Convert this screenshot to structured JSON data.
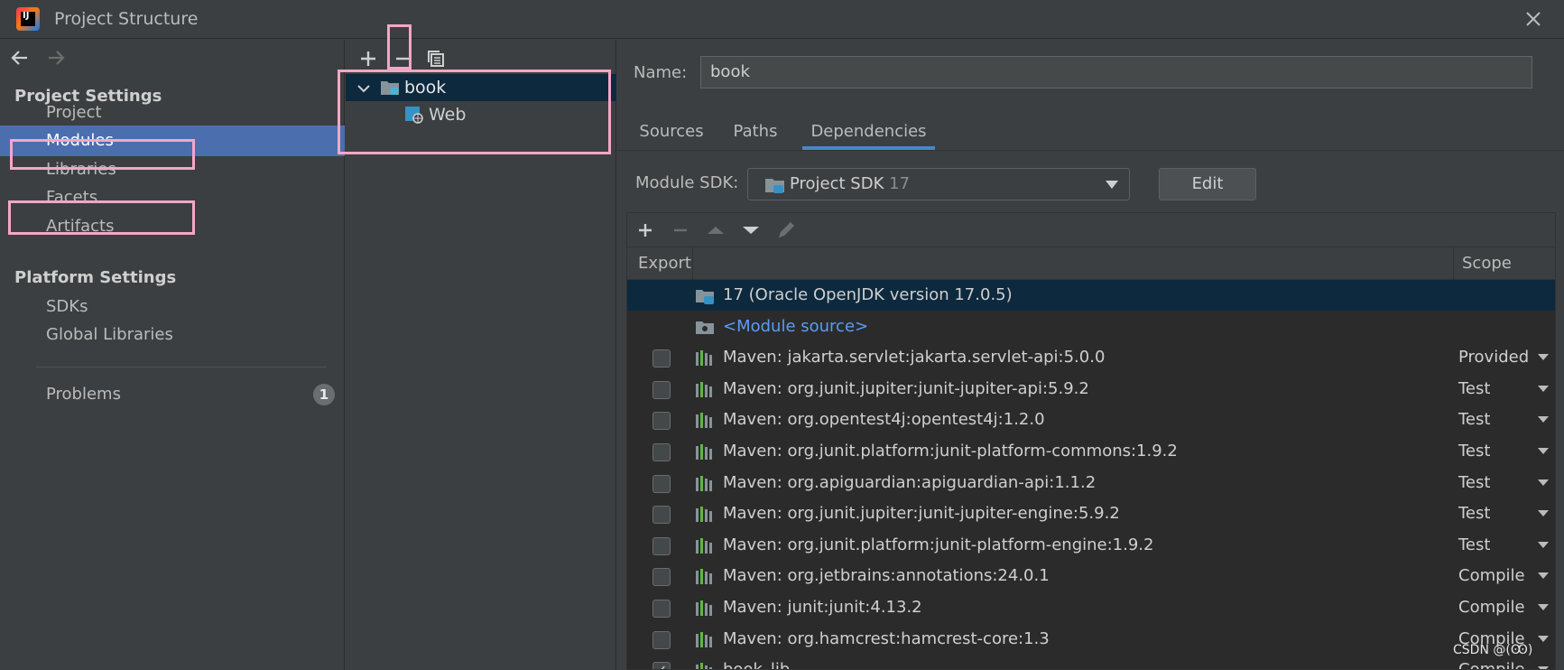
{
  "window": {
    "title": "Project Structure",
    "logo_text": "IJ"
  },
  "sidebar": {
    "project_settings_title": "Project Settings",
    "platform_settings_title": "Platform Settings",
    "project_items": [
      {
        "label": "Project"
      },
      {
        "label": "Modules",
        "selected": true
      },
      {
        "label": "Libraries"
      },
      {
        "label": "Facets"
      },
      {
        "label": "Artifacts"
      }
    ],
    "platform_items": [
      {
        "label": "SDKs"
      },
      {
        "label": "Global Libraries"
      }
    ],
    "problems_label": "Problems",
    "problems_count": "1"
  },
  "tree": {
    "items": [
      {
        "label": "book",
        "level": 0,
        "expanded": true,
        "selected": true,
        "icon": "module-folder-icon"
      },
      {
        "label": "Web",
        "level": 1,
        "icon": "web-facet-icon"
      }
    ]
  },
  "module": {
    "name_label": "Name:",
    "name_value": "book",
    "tabs": [
      {
        "label": "Sources"
      },
      {
        "label": "Paths"
      },
      {
        "label": "Dependencies",
        "active": true
      }
    ],
    "sdk_label": "Module SDK:",
    "sdk_value": "Project SDK",
    "sdk_version": "17",
    "edit_label": "Edit"
  },
  "dependencies": {
    "export_header": "Export",
    "scope_header": "Scope",
    "rows": [
      {
        "name": "17 (Oracle OpenJDK version 17.0.5)",
        "type": "sdk",
        "scope": "",
        "checkbox": false,
        "selected": true
      },
      {
        "name": "<Module source>",
        "type": "source",
        "scope": "",
        "checkbox": false
      },
      {
        "name": "Maven: jakarta.servlet:jakarta.servlet-api:5.0.0",
        "type": "library",
        "scope": "Provided",
        "checkbox": true,
        "checked": false
      },
      {
        "name": "Maven: org.junit.jupiter:junit-jupiter-api:5.9.2",
        "type": "library",
        "scope": "Test",
        "checkbox": true,
        "checked": false
      },
      {
        "name": "Maven: org.opentest4j:opentest4j:1.2.0",
        "type": "library",
        "scope": "Test",
        "checkbox": true,
        "checked": false
      },
      {
        "name": "Maven: org.junit.platform:junit-platform-commons:1.9.2",
        "type": "library",
        "scope": "Test",
        "checkbox": true,
        "checked": false
      },
      {
        "name": "Maven: org.apiguardian:apiguardian-api:1.1.2",
        "type": "library",
        "scope": "Test",
        "checkbox": true,
        "checked": false
      },
      {
        "name": "Maven: org.junit.jupiter:junit-jupiter-engine:5.9.2",
        "type": "library",
        "scope": "Test",
        "checkbox": true,
        "checked": false
      },
      {
        "name": "Maven: org.junit.platform:junit-platform-engine:1.9.2",
        "type": "library",
        "scope": "Test",
        "checkbox": true,
        "checked": false
      },
      {
        "name": "Maven: org.jetbrains:annotations:24.0.1",
        "type": "library",
        "scope": "Compile",
        "checkbox": true,
        "checked": false
      },
      {
        "name": "Maven: junit:junit:4.13.2",
        "type": "library",
        "scope": "Compile",
        "checkbox": true,
        "checked": false
      },
      {
        "name": "Maven: org.hamcrest:hamcrest-core:1.3",
        "type": "library",
        "scope": "Compile",
        "checkbox": true,
        "checked": false
      },
      {
        "name": "book_lib",
        "type": "library",
        "scope": "Compile",
        "checkbox": true,
        "checked": true
      }
    ]
  },
  "watermark": "CSDN @(Ꙭ)",
  "colors": {
    "background": "#3c3f41",
    "selection": "#4b6eaf",
    "tree_selection": "#0d293e",
    "link": "#589df6",
    "annotation": "#f4a6c6"
  }
}
